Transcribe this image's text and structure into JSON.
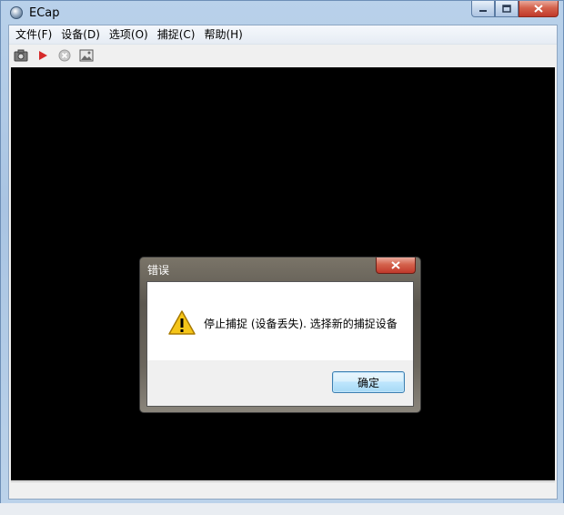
{
  "window": {
    "title": "ECap",
    "minimize_icon": "minimize-icon",
    "maximize_icon": "maximize-icon",
    "close_icon": "close-icon"
  },
  "menubar": {
    "items": [
      "文件(F)",
      "设备(D)",
      "选项(O)",
      "捕捉(C)",
      "帮助(H)"
    ]
  },
  "toolbar": {
    "icons": [
      "camera-icon",
      "play-icon",
      "stop-icon",
      "image-icon"
    ]
  },
  "statusbar": {
    "text": ""
  },
  "dialog": {
    "title": "错误",
    "message": "停止捕捉 (设备丢失). 选择新的捕捉设备",
    "ok_label": "确定",
    "icon": "warning-icon"
  },
  "colors": {
    "video_background": "#000000",
    "close_red": "#c0392b",
    "ok_border": "#3c7fb1",
    "warning_yellow": "#f5c518"
  }
}
